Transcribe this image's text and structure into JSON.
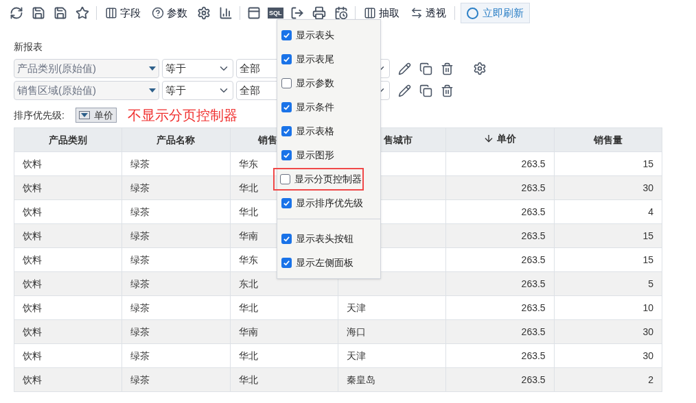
{
  "toolbar": {
    "items": [
      {
        "kind": "icon"
      },
      {
        "kind": "icon"
      },
      {
        "kind": "icon"
      },
      {
        "kind": "icon"
      },
      {
        "kind": "sep"
      },
      {
        "kind": "labeled",
        "label": "字段"
      },
      {
        "kind": "labeled",
        "label": "参数"
      },
      {
        "kind": "icon"
      },
      {
        "kind": "icon"
      },
      {
        "kind": "sep"
      },
      {
        "kind": "icon"
      },
      {
        "kind": "sql",
        "label": "SQL"
      },
      {
        "kind": "icon"
      },
      {
        "kind": "icon"
      },
      {
        "kind": "icon"
      },
      {
        "kind": "sep"
      },
      {
        "kind": "labeled",
        "label": "抽取"
      },
      {
        "kind": "labeled",
        "label": "透视"
      },
      {
        "kind": "sep"
      },
      {
        "kind": "refresh_button",
        "label": "立即刷新"
      }
    ]
  },
  "report_title": "新报表",
  "filters": [
    {
      "field": "产品类别(原始值)",
      "operator": "等于",
      "value": "全部",
      "settings": true
    },
    {
      "field": "销售区域(原始值)",
      "operator": "等于",
      "value": "全部",
      "settings": false
    }
  ],
  "sort": {
    "label": "排序优先级:",
    "item": "单价"
  },
  "annotation": "不显示分页控制器",
  "table": {
    "columns": [
      {
        "label": "产品类别",
        "sorted": false
      },
      {
        "label": "产品名称",
        "sorted": false
      },
      {
        "label": "销售",
        "sorted": false
      },
      {
        "label": "售城市",
        "sorted": false
      },
      {
        "label": "单价",
        "sorted": true
      },
      {
        "label": "销售量",
        "sorted": false
      }
    ],
    "rows": [
      [
        "饮料",
        "绿茶",
        "华东",
        null,
        "263.5",
        "15"
      ],
      [
        "饮料",
        "绿茶",
        "华北",
        null,
        "263.5",
        "30"
      ],
      [
        "饮料",
        "绿茶",
        "华北",
        null,
        "263.5",
        "4"
      ],
      [
        "饮料",
        "绿茶",
        "华南",
        null,
        "263.5",
        "15"
      ],
      [
        "饮料",
        "绿茶",
        "华东",
        null,
        "263.5",
        "15"
      ],
      [
        "饮料",
        "绿茶",
        "东北",
        null,
        "263.5",
        "5"
      ],
      [
        "饮料",
        "绿茶",
        "华北",
        "天津",
        "263.5",
        "10"
      ],
      [
        "饮料",
        "绿茶",
        "华南",
        "海口",
        "263.5",
        "30"
      ],
      [
        "饮料",
        "绿茶",
        "华北",
        "天津",
        "263.5",
        "30"
      ],
      [
        "饮料",
        "绿茶",
        "华北",
        "秦皇岛",
        "263.5",
        "2"
      ]
    ]
  },
  "menu": {
    "groups": [
      [
        {
          "label": "显示表头",
          "checked": true,
          "highlighted": false
        },
        {
          "label": "显示表尾",
          "checked": true,
          "highlighted": false
        },
        {
          "label": "显示参数",
          "checked": false,
          "highlighted": false
        },
        {
          "label": "显示条件",
          "checked": true,
          "highlighted": false
        },
        {
          "label": "显示表格",
          "checked": true,
          "highlighted": false
        },
        {
          "label": "显示图形",
          "checked": true,
          "highlighted": false
        },
        {
          "label": "显示分页控制器",
          "checked": false,
          "highlighted": true
        },
        {
          "label": "显示排序优先级",
          "checked": true,
          "highlighted": false
        }
      ],
      [
        {
          "label": "显示表头按钮",
          "checked": true,
          "highlighted": false
        },
        {
          "label": "显示左侧面板",
          "checked": true,
          "highlighted": false
        }
      ]
    ]
  }
}
